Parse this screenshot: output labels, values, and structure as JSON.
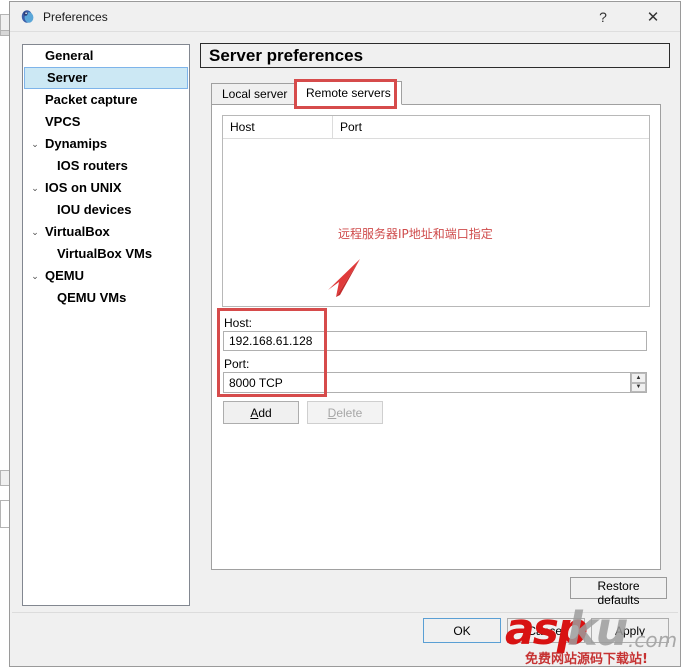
{
  "window": {
    "title": "Preferences",
    "icon": "gns3-app-icon",
    "help_label": "?",
    "close_label": "✕"
  },
  "sidebar": {
    "items": [
      {
        "label": "General",
        "level": 0,
        "arrow": "",
        "selected": false
      },
      {
        "label": "Server",
        "level": 0,
        "arrow": "",
        "selected": true
      },
      {
        "label": "Packet capture",
        "level": 0,
        "arrow": "",
        "selected": false
      },
      {
        "label": "VPCS",
        "level": 0,
        "arrow": "",
        "selected": false
      },
      {
        "label": "Dynamips",
        "level": 0,
        "arrow": "⌄",
        "selected": false
      },
      {
        "label": "IOS routers",
        "level": 1,
        "arrow": "",
        "selected": false
      },
      {
        "label": "IOS on UNIX",
        "level": 0,
        "arrow": "⌄",
        "selected": false
      },
      {
        "label": "IOU devices",
        "level": 1,
        "arrow": "",
        "selected": false
      },
      {
        "label": "VirtualBox",
        "level": 0,
        "arrow": "⌄",
        "selected": false
      },
      {
        "label": "VirtualBox VMs",
        "level": 1,
        "arrow": "",
        "selected": false
      },
      {
        "label": "QEMU",
        "level": 0,
        "arrow": "⌄",
        "selected": false
      },
      {
        "label": "QEMU VMs",
        "level": 1,
        "arrow": "",
        "selected": false
      }
    ]
  },
  "main": {
    "page_title": "Server preferences",
    "tabs": [
      {
        "label": "Local server",
        "active": false
      },
      {
        "label": "Remote servers",
        "active": true
      }
    ],
    "table": {
      "columns": [
        "Host",
        "Port"
      ],
      "rows": []
    },
    "annotation": {
      "text": "远程服务器IP地址和端口指定",
      "color": "#cf4b4b"
    },
    "form": {
      "host_label": "Host:",
      "host_value": "192.168.61.128",
      "port_label": "Port:",
      "port_value": "8000 TCP",
      "add_label_pre": "",
      "add_label_mnemonic": "A",
      "add_label_post": "dd",
      "delete_label_pre": "",
      "delete_label_mnemonic": "D",
      "delete_label_post": "elete",
      "delete_enabled": false
    },
    "restore_defaults_label": "Restore defaults"
  },
  "footer": {
    "ok_label": "OK",
    "cancel_label": "Cancel",
    "apply_label": "Apply"
  },
  "watermark": {
    "part_red": "asp",
    "part_gray": "ku",
    "part_domain": ".com",
    "subtitle": "免费网站源码下载站!"
  },
  "highlight_color": "#d64b4b"
}
